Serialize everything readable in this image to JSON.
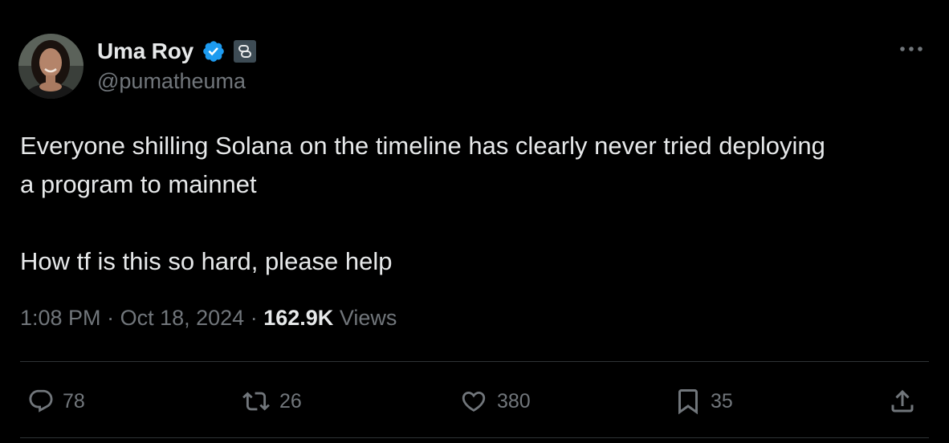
{
  "author": {
    "display_name": "Uma Roy",
    "handle": "@pumatheuma",
    "verified": true,
    "affiliation_badge": "link-badge-icon",
    "avatar": "profile-photo"
  },
  "tweet": {
    "text": "Everyone shilling Solana on the timeline has clearly never tried deploying\na program to mainnet\n\nHow tf is this so hard, please help",
    "time": "1:08 PM",
    "separator": "·",
    "date": "Oct 18, 2024",
    "views_count": "162.9K",
    "views_label": "Views"
  },
  "actions": {
    "replies": "78",
    "retweets": "26",
    "likes": "380",
    "bookmarks": "35"
  },
  "icons": {
    "more": "more-dots-icon",
    "reply": "reply-icon",
    "retweet": "retweet-icon",
    "like": "heart-icon",
    "bookmark": "bookmark-icon",
    "share": "share-icon"
  },
  "colors": {
    "background": "#000000",
    "text_primary": "#e7e9ea",
    "text_secondary": "#71767b",
    "verified_blue": "#1d9bf0",
    "divider": "#2f3336"
  }
}
